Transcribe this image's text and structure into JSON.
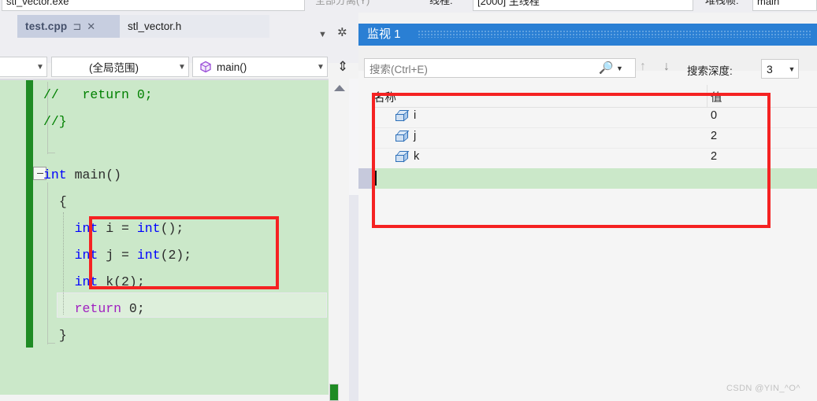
{
  "top_strip": {
    "target_combo_value": "stl_vector.exe",
    "attach_label": "全部分离(Y)",
    "process_label": "线程:",
    "thread_combo_value": "[2000] 主线程",
    "stackframe_label": "堆栈帧:",
    "stackframe_value": "main"
  },
  "tabs": {
    "active": {
      "label": "test.cpp",
      "pin_icon": "pin-icon",
      "close_icon": "close-icon"
    },
    "inactive": {
      "label": "stl_vector.h"
    },
    "dropdown_icon": "chevron-down-icon",
    "settings_icon": "gear-icon"
  },
  "navbar": {
    "left_combo_value": "",
    "scope_combo_value": "(全局范围)",
    "function_combo_value": "main()",
    "function_icon": "method-cube-icon",
    "split_view_icon": "split-view-icon"
  },
  "editor": {
    "lines": [
      {
        "indent": 0,
        "segments": [
          {
            "t": "//   return 0;",
            "c": "cmt"
          }
        ]
      },
      {
        "indent": 0,
        "segments": [
          {
            "t": "//}",
            "c": "cmt"
          }
        ]
      },
      {
        "indent": 0,
        "segments": [
          {
            "t": "",
            "c": "pl"
          }
        ]
      },
      {
        "indent": 0,
        "segments": [
          {
            "t": "int",
            "c": "kw"
          },
          {
            "t": " main()",
            "c": "pl"
          }
        ]
      },
      {
        "indent": 1,
        "segments": [
          {
            "t": "{",
            "c": "pl"
          }
        ]
      },
      {
        "indent": 2,
        "segments": [
          {
            "t": "int",
            "c": "kw"
          },
          {
            "t": " i = ",
            "c": "pl"
          },
          {
            "t": "int",
            "c": "kw"
          },
          {
            "t": "();",
            "c": "pl"
          }
        ]
      },
      {
        "indent": 2,
        "segments": [
          {
            "t": "int",
            "c": "kw"
          },
          {
            "t": " j = ",
            "c": "pl"
          },
          {
            "t": "int",
            "c": "kw"
          },
          {
            "t": "(2);",
            "c": "pl"
          }
        ]
      },
      {
        "indent": 2,
        "segments": [
          {
            "t": "int",
            "c": "kw"
          },
          {
            "t": " k(2);",
            "c": "pl"
          }
        ]
      },
      {
        "indent": 2,
        "segments": [
          {
            "t": "return",
            "c": "ret"
          },
          {
            "t": " 0;",
            "c": "pl"
          }
        ]
      },
      {
        "indent": 1,
        "segments": [
          {
            "t": "}",
            "c": "pl"
          }
        ]
      }
    ],
    "fold_icon": "collapse-minus-icon",
    "scroll_up_icon": "scroll-up-arrow-icon",
    "change_marker_color": "#1f8b24",
    "changed_bg_color": "#cbe8c9"
  },
  "watch": {
    "title": "监视 1",
    "search_placeholder": "搜索(Ctrl+E)",
    "search_icon": "search-icon",
    "search_dropdown_icon": "chevron-down-icon",
    "prev_icon": "arrow-up-icon",
    "next_icon": "arrow-down-icon",
    "depth_label": "搜索深度:",
    "depth_value": "3",
    "depth_dropdown_icon": "chevron-down-icon",
    "columns": [
      "名称",
      "值"
    ],
    "rows": [
      {
        "icon": "variable-box-icon",
        "name": "i",
        "value": "0"
      },
      {
        "icon": "variable-box-icon",
        "name": "j",
        "value": "2"
      },
      {
        "icon": "variable-box-icon",
        "name": "k",
        "value": "2"
      }
    ],
    "new_row_placeholder": ""
  },
  "annotations": {
    "highlight_color": "#f52222",
    "code_box_label": "",
    "watch_box_label": ""
  },
  "watermark": "CSDN @YIN_^O^"
}
